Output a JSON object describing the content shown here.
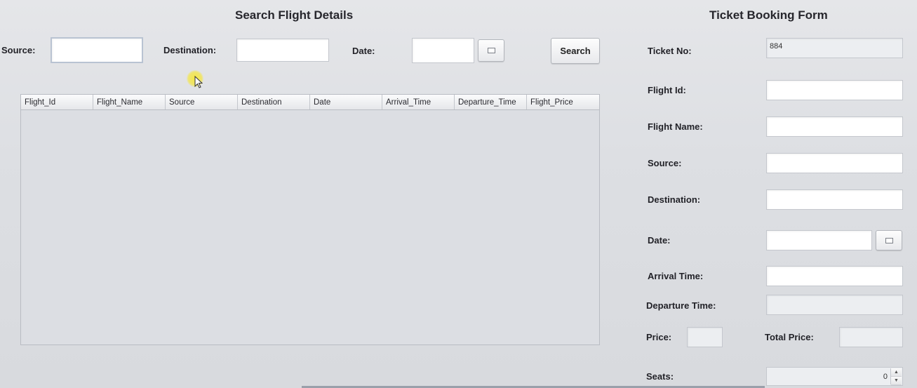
{
  "search_panel": {
    "title": "Search Flight Details",
    "source_label": "Source:",
    "source_value": "",
    "destination_label": "Destination:",
    "destination_value": "",
    "date_label": "Date:",
    "date_value": "",
    "date_picker_icon": "calendar-icon",
    "search_button": "Search",
    "table": {
      "columns": [
        "Flight_Id",
        "Flight_Name",
        "Source",
        "Destination",
        "Date",
        "Arrival_Time",
        "Departure_Time",
        "Flight_Price"
      ],
      "rows": []
    }
  },
  "booking_form": {
    "title": "Ticket Booking Form",
    "ticket_no_label": "Ticket No:",
    "ticket_no_value": "884",
    "flight_id_label": "Flight Id:",
    "flight_id_value": "",
    "flight_name_label": "Flight Name:",
    "flight_name_value": "",
    "source_label": "Source:",
    "source_value": "",
    "destination_label": "Destination:",
    "destination_value": "",
    "date_label": "Date:",
    "date_value": "",
    "date_picker_icon": "calendar-icon",
    "arrival_time_label": "Arrival Time:",
    "arrival_time_value": "",
    "departure_time_label": "Departure Time:",
    "departure_time_value": "",
    "price_label": "Price:",
    "price_value": "",
    "total_price_label": "Total Price:",
    "total_price_value": "",
    "seats_label": "Seats:",
    "seats_value": "0"
  }
}
